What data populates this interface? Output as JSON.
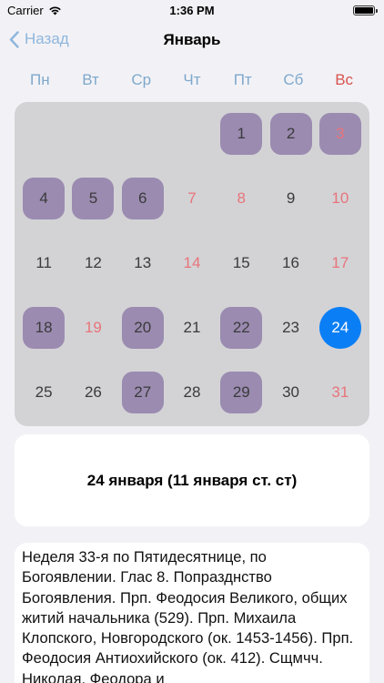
{
  "status_bar": {
    "carrier": "Carrier",
    "time": "1:36 PM"
  },
  "nav": {
    "back_label": "Назад",
    "title": "Январь"
  },
  "weekdays": [
    "Пн",
    "Вт",
    "Ср",
    "Чт",
    "Пт",
    "Сб",
    "Вс"
  ],
  "calendar": {
    "leading_blanks": 4,
    "days": [
      {
        "n": "1",
        "hl": true,
        "red": false
      },
      {
        "n": "2",
        "hl": true,
        "red": false
      },
      {
        "n": "3",
        "hl": true,
        "red": true
      },
      {
        "n": "4",
        "hl": true,
        "red": false
      },
      {
        "n": "5",
        "hl": true,
        "red": false
      },
      {
        "n": "6",
        "hl": true,
        "red": false
      },
      {
        "n": "7",
        "hl": false,
        "red": true
      },
      {
        "n": "8",
        "hl": false,
        "red": true
      },
      {
        "n": "9",
        "hl": false,
        "red": false
      },
      {
        "n": "10",
        "hl": false,
        "red": true
      },
      {
        "n": "11",
        "hl": false,
        "red": false
      },
      {
        "n": "12",
        "hl": false,
        "red": false
      },
      {
        "n": "13",
        "hl": false,
        "red": false
      },
      {
        "n": "14",
        "hl": false,
        "red": true
      },
      {
        "n": "15",
        "hl": false,
        "red": false
      },
      {
        "n": "16",
        "hl": false,
        "red": false
      },
      {
        "n": "17",
        "hl": false,
        "red": true
      },
      {
        "n": "18",
        "hl": true,
        "red": false
      },
      {
        "n": "19",
        "hl": false,
        "red": true
      },
      {
        "n": "20",
        "hl": true,
        "red": false
      },
      {
        "n": "21",
        "hl": false,
        "red": false
      },
      {
        "n": "22",
        "hl": true,
        "red": false
      },
      {
        "n": "23",
        "hl": false,
        "red": false
      },
      {
        "n": "24",
        "hl": false,
        "red": false,
        "today": true
      },
      {
        "n": "25",
        "hl": false,
        "red": false
      },
      {
        "n": "26",
        "hl": false,
        "red": false
      },
      {
        "n": "27",
        "hl": true,
        "red": false
      },
      {
        "n": "28",
        "hl": false,
        "red": false
      },
      {
        "n": "29",
        "hl": true,
        "red": false
      },
      {
        "n": "30",
        "hl": false,
        "red": false
      },
      {
        "n": "31",
        "hl": false,
        "red": true
      }
    ]
  },
  "selected_date": {
    "title": "24 января (11 января ст. ст)"
  },
  "description": "Неделя 33-я по Пятидесятнице, по Богоявлении. Глас 8. Попразднство Богоявления. Прп. Феодосия Великого, общих житий начальника (529). Прп. Михаила Клопского, Новгородского (ок. 1453-1456). Прп. Феодосия Антиохийского (ок. 412). Сщмчч. Николая, Феодора и",
  "colors": {
    "accent": "#0a7ef5",
    "highlight_day": "#9b8bb0",
    "holiday_red": "#e8747a",
    "weekday_blue": "#7fa8cc",
    "calendar_bg": "#d3d3d6"
  }
}
